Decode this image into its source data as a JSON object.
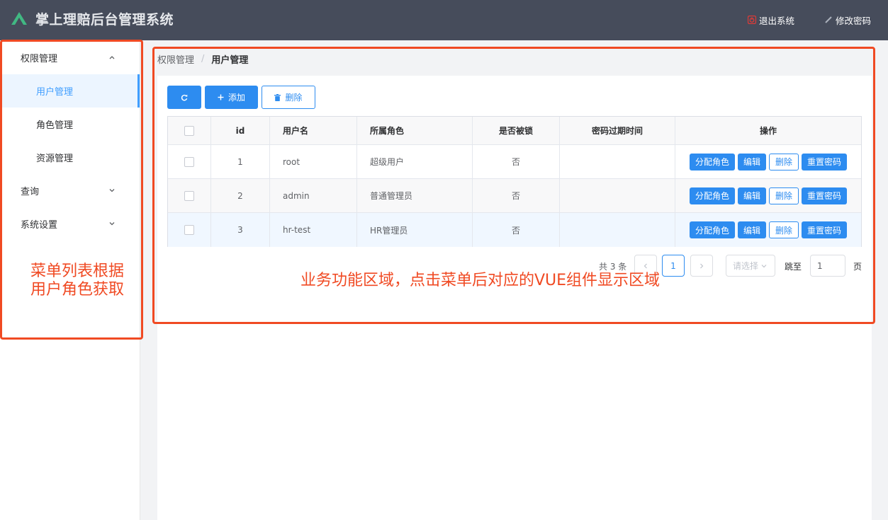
{
  "header": {
    "title": "掌上理赔后台管理系统",
    "logout_label": "退出系统",
    "change_password_label": "修改密码"
  },
  "sidebar": {
    "groups": [
      {
        "label": "权限管理",
        "expanded": true,
        "items": [
          {
            "label": "用户管理",
            "active": true
          },
          {
            "label": "角色管理"
          },
          {
            "label": "资源管理"
          }
        ]
      },
      {
        "label": "查询",
        "expanded": false
      },
      {
        "label": "系统设置",
        "expanded": false
      }
    ]
  },
  "breadcrumb": {
    "parent": "权限管理",
    "separator": "/",
    "current": "用户管理"
  },
  "toolbar": {
    "add_label": "添加",
    "delete_label": "删除"
  },
  "table": {
    "columns": [
      "id",
      "用户名",
      "所属角色",
      "是否被锁",
      "密码过期时间",
      "操作"
    ],
    "rows": [
      {
        "id": "1",
        "username": "root",
        "role": "超级用户",
        "locked": "否",
        "expire": ""
      },
      {
        "id": "2",
        "username": "admin",
        "role": "普通管理员",
        "locked": "否",
        "expire": ""
      },
      {
        "id": "3",
        "username": "hr-test",
        "role": "HR管理员",
        "locked": "否",
        "expire": ""
      }
    ],
    "actions": {
      "assign_role": "分配角色",
      "edit": "编辑",
      "delete": "删除",
      "reset_password": "重置密码"
    }
  },
  "pagination": {
    "total_text": "共 3 条",
    "current_page": "1",
    "page_size_placeholder": "请选择",
    "jump_label": "跳至",
    "jump_value": "1",
    "page_suffix": "页"
  },
  "annotations": {
    "sidebar_note_line1": "菜单列表根据",
    "sidebar_note_line2": "用户角色获取",
    "main_note": "业务功能区域，点击菜单后对应的VUE组件显示区域"
  },
  "colors": {
    "header_bg": "#464c5b",
    "primary": "#2d8cf0",
    "menu_active_bg": "#ecf5ff",
    "annotation": "#f04a23",
    "logo_green": "#41b883"
  }
}
